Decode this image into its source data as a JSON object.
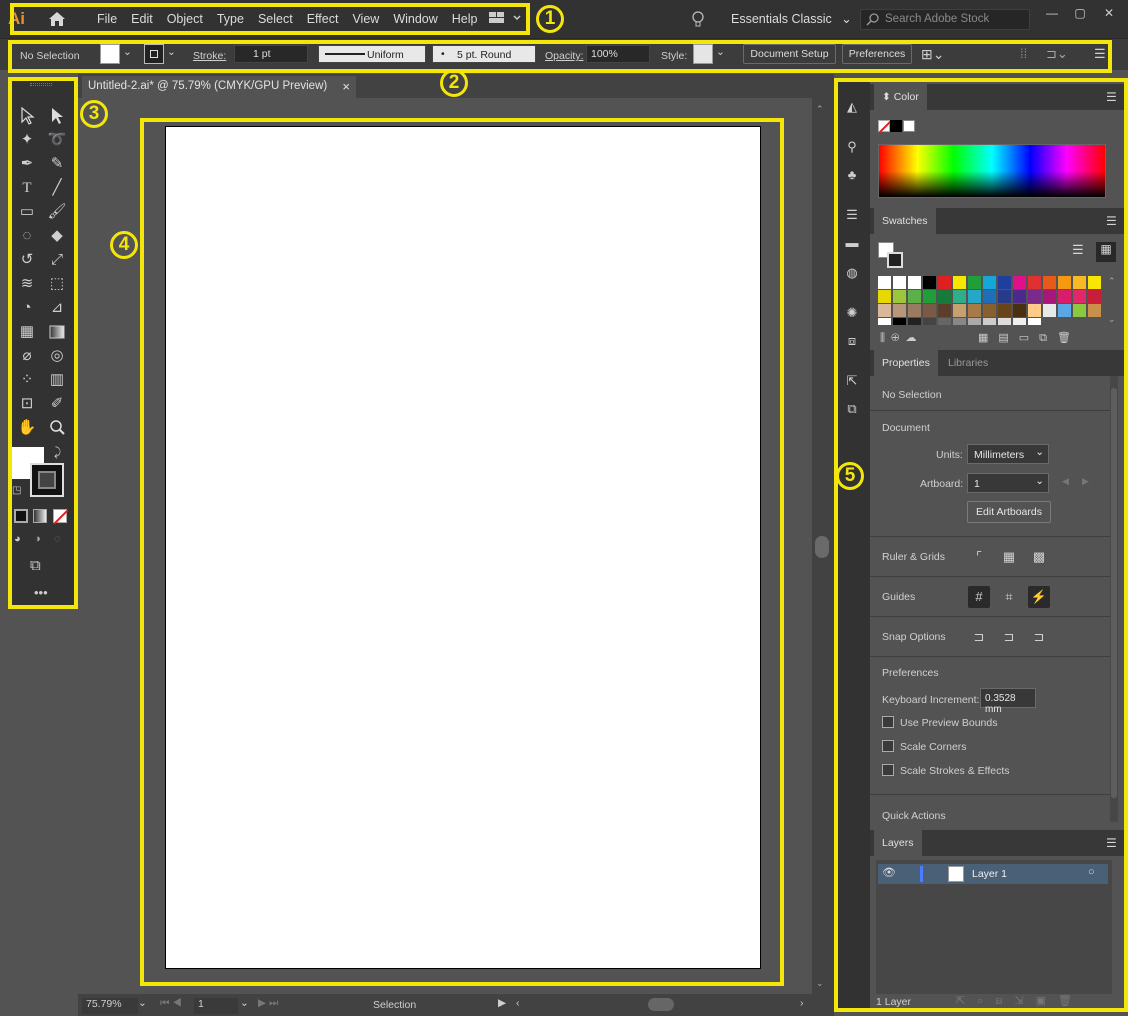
{
  "app": {
    "logo": "Ai"
  },
  "menu": [
    "File",
    "Edit",
    "Object",
    "Type",
    "Select",
    "Effect",
    "View",
    "Window",
    "Help"
  ],
  "workspace": "Essentials Classic",
  "search_placeholder": "Search Adobe Stock",
  "control_bar": {
    "selection": "No Selection",
    "stroke_label": "Stroke:",
    "stroke_value": "1 pt",
    "profile": "Uniform",
    "brush": "5 pt. Round",
    "opacity_label": "Opacity:",
    "opacity_value": "100%",
    "style_label": "Style:",
    "doc_setup": "Document Setup",
    "preferences": "Preferences"
  },
  "annotations": [
    "1",
    "2",
    "3",
    "4",
    "5"
  ],
  "document": {
    "tab_title": "Untitled-2.ai* @ 75.79% (CMYK/GPU Preview)",
    "close": "×"
  },
  "status": {
    "zoom": "75.79%",
    "artboard_num": "1",
    "tool": "Selection"
  },
  "color_panel": {
    "title": "Color"
  },
  "swatches_panel": {
    "title": "Swatches"
  },
  "properties_panel": {
    "tabs": [
      "Properties",
      "Libraries"
    ],
    "selection": "No Selection",
    "document_heading": "Document",
    "units_label": "Units:",
    "units_value": "Millimeters",
    "artboard_label": "Artboard:",
    "artboard_value": "1",
    "edit_artboards": "Edit Artboards",
    "ruler_grids": "Ruler & Grids",
    "guides": "Guides",
    "snap_options": "Snap Options",
    "preferences_heading": "Preferences",
    "keyboard_increment_label": "Keyboard Increment:",
    "keyboard_increment_value": "0.3528 mm",
    "checkboxes": [
      "Use Preview Bounds",
      "Scale Corners",
      "Scale Strokes & Effects"
    ],
    "quick_actions": "Quick Actions"
  },
  "layers_panel": {
    "title": "Layers",
    "layer_name": "Layer 1",
    "count": "1 Layer"
  },
  "colors": {
    "highlight": "#f5e60a",
    "accent": "#e8912b",
    "layer_select": "#4a6076"
  }
}
